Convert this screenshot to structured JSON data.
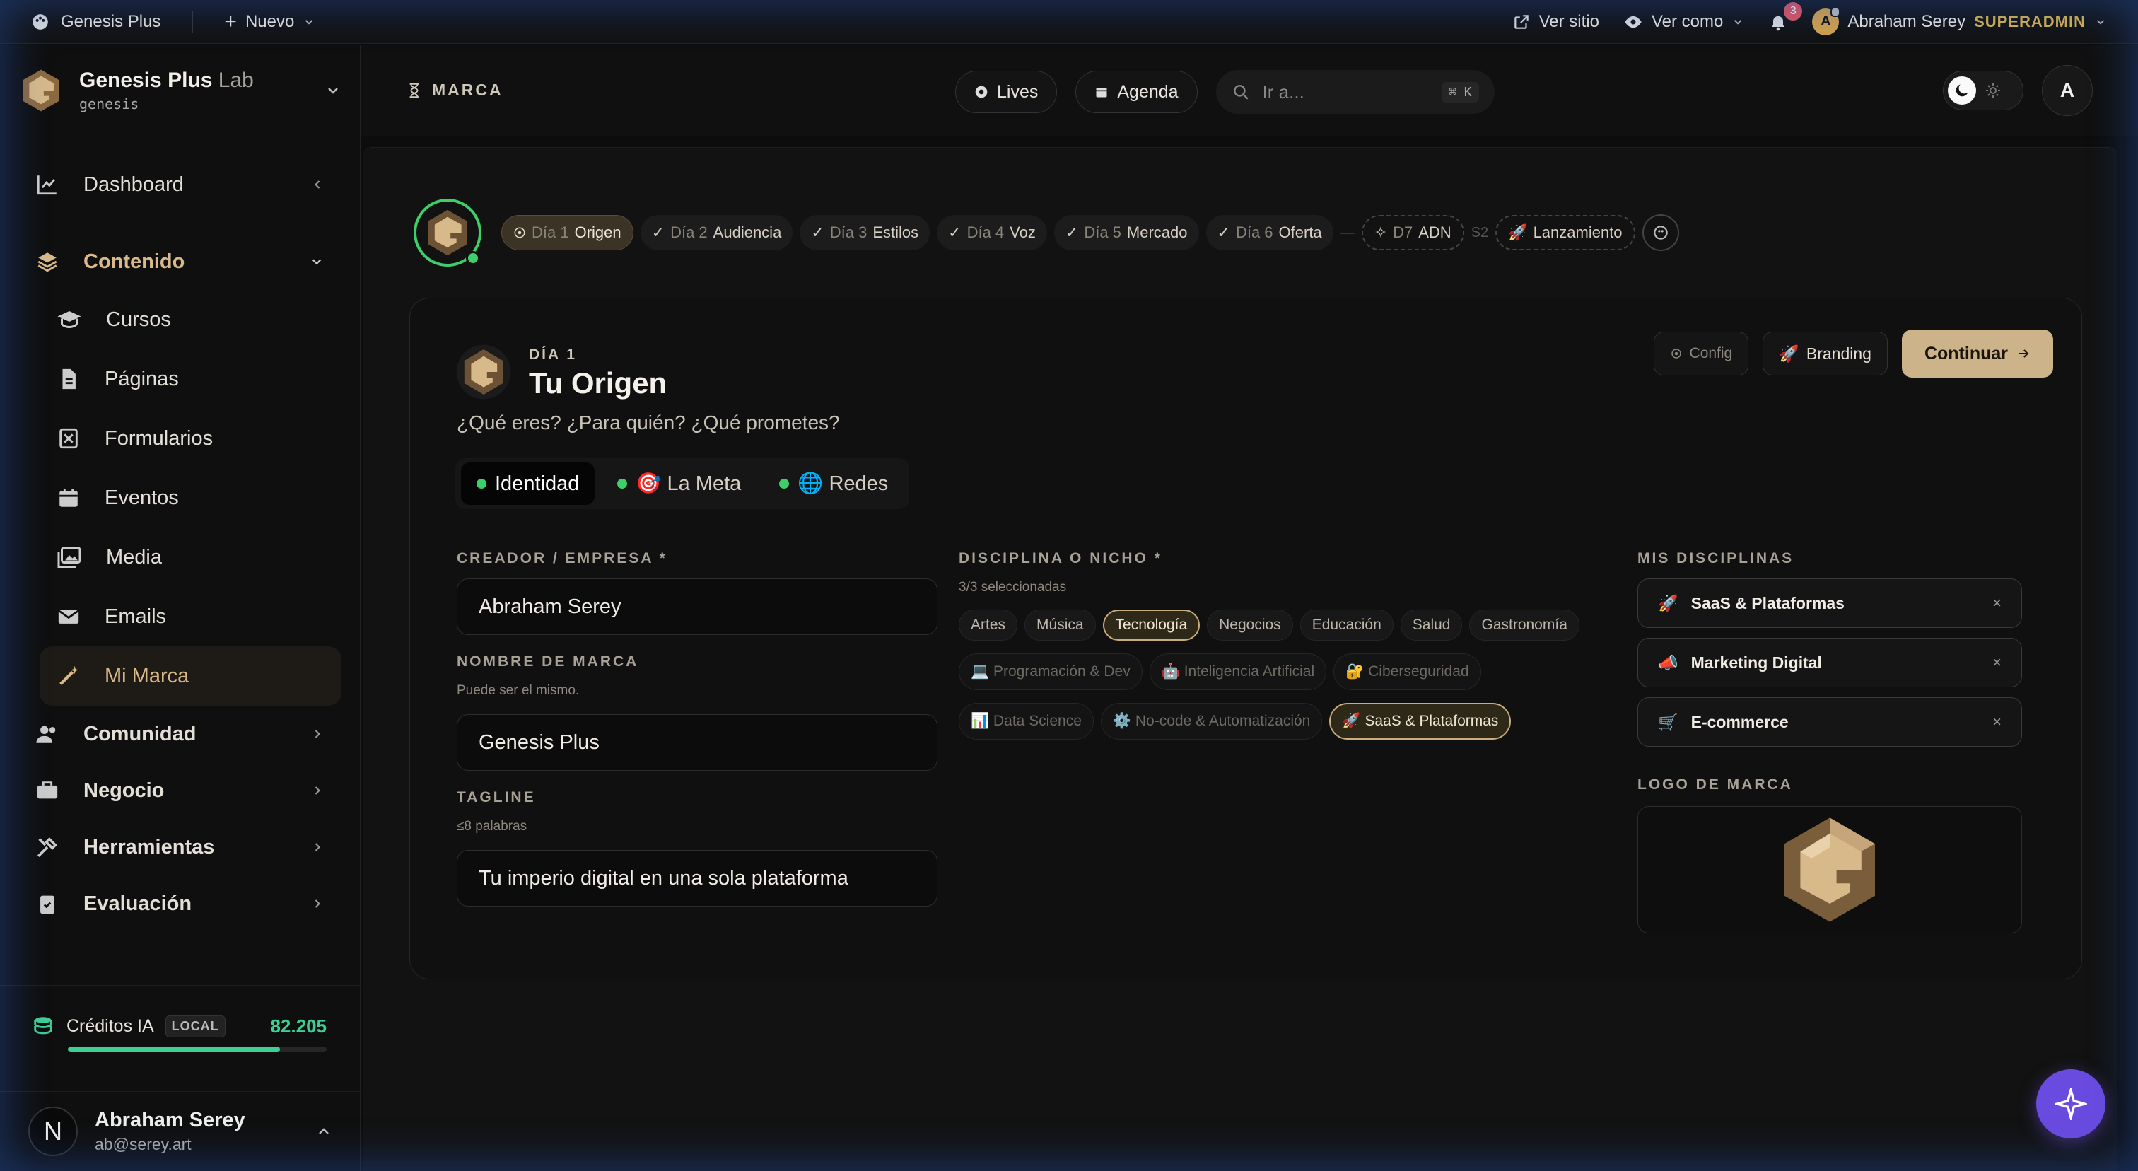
{
  "topbar": {
    "brand": "Genesis Plus",
    "new_label": "Nuevo",
    "view_site": "Ver sitio",
    "view_as": "Ver como",
    "notifications": "3",
    "user_initial": "A",
    "user_name": "Abraham Serey",
    "role": "SUPERADMIN"
  },
  "workspace": {
    "title": "Genesis Plus",
    "title_suffix": "Lab",
    "slug": "genesis"
  },
  "sidebar": {
    "dashboard": "Dashboard",
    "contenido": "Contenido",
    "sub": [
      "Cursos",
      "Páginas",
      "Formularios",
      "Eventos",
      "Media",
      "Emails",
      "Mi Marca"
    ],
    "comunidad": "Comunidad",
    "negocio": "Negocio",
    "herramientas": "Herramientas",
    "evaluacion": "Evaluación"
  },
  "credits": {
    "label": "Créditos IA",
    "badge": "LOCAL",
    "value": "82.205",
    "fill_fraction": 0.82
  },
  "user": {
    "initial": "N",
    "name": "Abraham Serey",
    "email": "ab@serey.art"
  },
  "header": {
    "section": "MARCA",
    "lives": "Lives",
    "agenda": "Agenda",
    "search_placeholder": "Ir a...",
    "shortcut": "⌘ K",
    "avatar": "A"
  },
  "steps": [
    {
      "d": "Día 1",
      "n": "Origen",
      "active": true
    },
    {
      "d": "Día 2",
      "n": "Audiencia"
    },
    {
      "d": "Día 3",
      "n": "Estilos"
    },
    {
      "d": "Día 4",
      "n": "Voz"
    },
    {
      "d": "Día 5",
      "n": "Mercado"
    },
    {
      "d": "Día 6",
      "n": "Oferta"
    }
  ],
  "steps_extra": {
    "d7_prefix": "D7",
    "d7_name": "ADN",
    "s2": "S2",
    "launch": "Lanzamiento"
  },
  "card": {
    "kicker": "DÍA 1",
    "title": "Tu Origen",
    "subtitle": "¿Qué eres? ¿Para quién? ¿Qué prometes?",
    "config": "Config",
    "branding": "Branding",
    "continue": "Continuar"
  },
  "tabs": [
    "Identidad",
    "🎯 La Meta",
    "🌐 Redes"
  ],
  "form": {
    "creator_label": "CREADOR / EMPRESA *",
    "creator_value": "Abraham Serey",
    "brand_label": "NOMBRE DE MARCA",
    "brand_hint": "Puede ser el mismo.",
    "brand_value": "Genesis Plus",
    "tagline_label": "TAGLINE",
    "tagline_hint": "≤8 palabras",
    "tagline_value": "Tu imperio digital en una sola plataforma"
  },
  "disciplines": {
    "label": "DISCIPLINA O NICHO *",
    "count": "3/3 seleccionadas",
    "row1": [
      "Artes",
      "Música",
      "Tecnología",
      "Negocios",
      "Educación",
      "Salud",
      "Gastronomía"
    ],
    "row2": [
      "💻 Programación & Dev",
      "🤖 Inteligencia Artificial",
      "🔐 Ciberseguridad"
    ],
    "row3": [
      "📊 Data Science",
      "⚙️ No-code & Automatización",
      "🚀 SaaS & Plataformas"
    ]
  },
  "mine": {
    "label": "MIS DISCIPLINAS",
    "items": [
      {
        "icon": "🚀",
        "name": "SaaS & Plataformas"
      },
      {
        "icon": "📣",
        "name": "Marketing Digital"
      },
      {
        "icon": "🛒",
        "name": "E-commerce"
      }
    ],
    "remove": "×",
    "logo_label": "LOGO DE MARCA"
  },
  "colors": {
    "accent": "#cdb38a",
    "success": "#3ecf6a",
    "credits": "#3ecf95",
    "fab": "#6a4be0",
    "role": "#d9b24a"
  }
}
